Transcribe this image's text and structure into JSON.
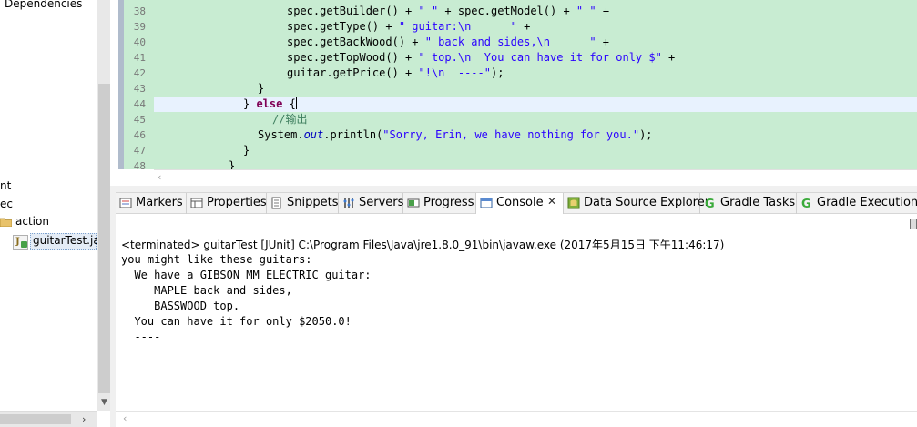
{
  "explorer": {
    "items": [
      {
        "label": "Dependencies"
      },
      {
        "label": "nt"
      },
      {
        "label": "ec"
      },
      {
        "label": "action"
      },
      {
        "label": "guitarTest.ja"
      }
    ]
  },
  "editor": {
    "lines": [
      {
        "no": "38"
      },
      {
        "no": "39"
      },
      {
        "no": "40"
      },
      {
        "no": "41"
      },
      {
        "no": "42"
      },
      {
        "no": "43"
      },
      {
        "no": "44"
      },
      {
        "no": "45"
      },
      {
        "no": "46"
      },
      {
        "no": "47"
      },
      {
        "no": "48"
      }
    ],
    "tokens": {
      "l38_a": "spec.getBuilder() + ",
      "l38_b": "\" \"",
      "l38_c": " + spec.getModel() + ",
      "l38_d": "\" \"",
      "l38_e": " +",
      "l39_a": "spec.getType() + ",
      "l39_b": "\" guitar:\\n      \"",
      "l39_c": " +",
      "l40_a": "spec.getBackWood() + ",
      "l40_b": "\" back and sides,\\n      \"",
      "l40_c": " +",
      "l41_a": "spec.getTopWood() + ",
      "l41_b": "\" top.\\n  You can have it for only $\"",
      "l41_c": " +",
      "l42_a": "guitar.getPrice() + ",
      "l42_b": "\"!\\n  ----\"",
      "l42_c": ");",
      "l43": "}",
      "l44_a": "} ",
      "l44_b": "else",
      "l44_c": " {",
      "l45": "//输出",
      "l46_a": "System.",
      "l46_b": "out",
      "l46_c": ".println(",
      "l46_d": "\"Sorry, Erin, we have nothing for you.\"",
      "l46_e": ");",
      "l47": "}",
      "l48": "}"
    }
  },
  "view_tabs": [
    {
      "label": "Markers",
      "icon": "markers-icon"
    },
    {
      "label": "Properties",
      "icon": "properties-icon"
    },
    {
      "label": "Snippets",
      "icon": "snippets-icon"
    },
    {
      "label": "Servers",
      "icon": "servers-icon"
    },
    {
      "label": "Progress",
      "icon": "progress-icon"
    },
    {
      "label": "Console",
      "icon": "console-icon",
      "active": true
    },
    {
      "label": "Data Source Explorer",
      "icon": "data-source-explorer-icon"
    },
    {
      "label": "Gradle Tasks",
      "icon": "gradle-icon"
    },
    {
      "label": "Gradle Executions",
      "icon": "gradle-icon"
    }
  ],
  "console": {
    "status": "<terminated> guitarTest [JUnit] C:\\Program Files\\Java\\jre1.8.0_91\\bin\\javaw.exe (2017年5月15日 下午11:46:17)",
    "output": [
      "you might like these guitars:",
      "  We have a GIBSON MM ELECTRIC guitar:",
      "     MAPLE back and sides,",
      "     BASSWOOD top.",
      "  You can have it for only $2050.0!",
      "  ----"
    ]
  },
  "colors": {
    "editor_background": "#c8ecd2",
    "current_line": "#e8f2fe",
    "keyword": "#7f0055",
    "string": "#2a00ff",
    "comment": "#3f7f5f",
    "field": "#0000c0"
  }
}
